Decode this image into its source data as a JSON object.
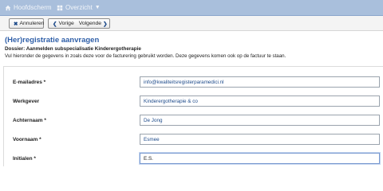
{
  "nav": {
    "home_label": "Hoofdscherm",
    "overview_label": "Overzicht"
  },
  "toolbar": {
    "cancel_label": "Annuleren",
    "prev_label": "Vorige",
    "next_label": "Volgende"
  },
  "page": {
    "title": "(Her)registratie aanvragen",
    "dossier": "Dossier: Aanmelden subspecialisatie Kinderergotherapie",
    "intro": "Vul hieronder de gegevens in zoals deze voor de facturering gebruikt worden. Deze gegevens komen ook op de factuur te staan."
  },
  "form": {
    "fields": [
      {
        "label": "E-mailadres *",
        "value": "info@kwaliteitsregisterparamedici.nl"
      },
      {
        "label": "Werkgever",
        "value": "Kinderergotherapie & co"
      },
      {
        "label": "Achternaam *",
        "value": "De Jong"
      },
      {
        "label": "Voornaam *",
        "value": "Esmee"
      },
      {
        "label": "Initialen *",
        "value": "E.S."
      }
    ]
  },
  "colors": {
    "topbar": "#a9bfdc",
    "title": "#2f5fa8",
    "input_text": "#1d4a8a"
  }
}
